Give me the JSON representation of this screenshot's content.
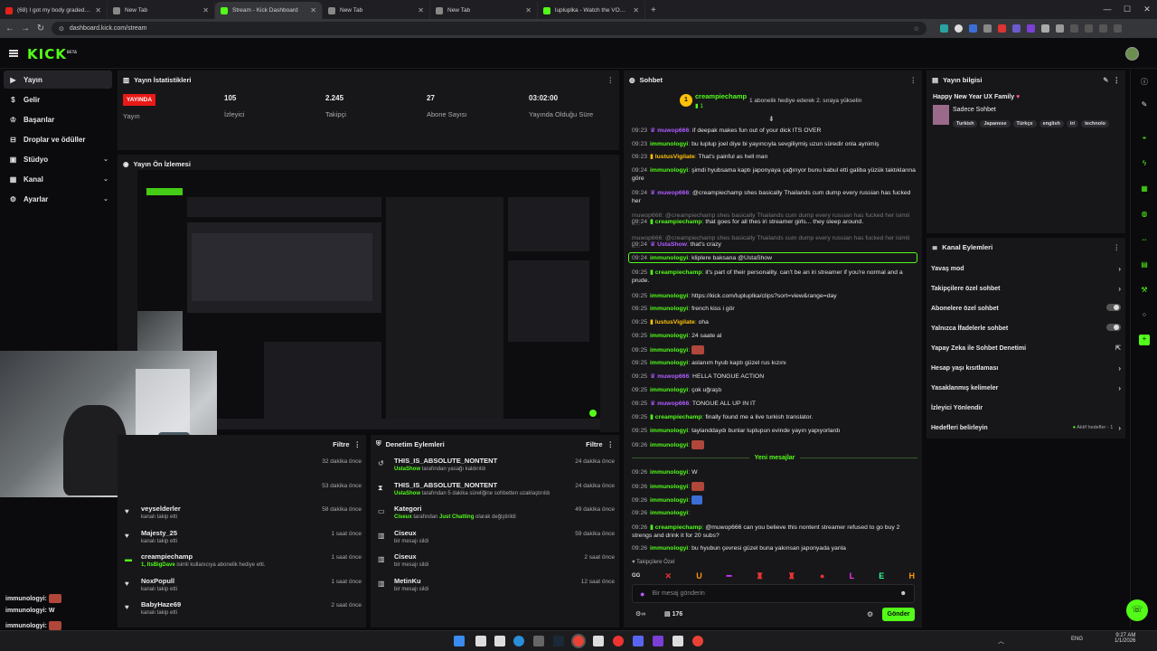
{
  "browser": {
    "tabs": [
      {
        "title": "(68) I got my body graded in a",
        "color": "#e62117"
      },
      {
        "title": "New Tab",
        "color": "#888888"
      },
      {
        "title": "Stream - Kick Dashboard",
        "color": "#53fc18"
      },
      {
        "title": "New Tab",
        "color": "#888888"
      },
      {
        "title": "New Tab",
        "color": "#888888"
      },
      {
        "title": "lupluplka - Watch the VOD on K",
        "color": "#53fc18"
      }
    ],
    "url": "dashboard.kick.com/stream"
  },
  "app": {
    "logo": "KICK",
    "logo_sup": "BETA"
  },
  "sidebar": {
    "items": [
      {
        "label": "Yayın",
        "icon": "stream-icon"
      },
      {
        "label": "Gelir",
        "icon": "revenue-icon"
      },
      {
        "label": "Başarılar",
        "icon": "trophy-icon"
      },
      {
        "label": "Droplar ve ödüller",
        "icon": "gift-icon"
      },
      {
        "label": "Stüdyo",
        "icon": "studio-icon"
      },
      {
        "label": "Kanal",
        "icon": "channel-icon"
      },
      {
        "label": "Ayarlar",
        "icon": "gear-icon"
      }
    ]
  },
  "stats": {
    "title": "Yayın İstatistikleri",
    "live_badge": "YAYINDA",
    "live_label": "Yayın",
    "viewers": "105",
    "viewers_label": "İzleyici",
    "followers": "2.245",
    "followers_label": "Takipçi",
    "subs": "27",
    "subs_label": "Abone Sayısı",
    "uptime": "03:02:00",
    "uptime_label": "Yayında Olduğu Süre"
  },
  "preview": {
    "title": "Yayın Ön İzlemesi"
  },
  "activity": {
    "filter": "Filtre",
    "items": [
      {
        "name": "",
        "sub": "",
        "time": "32 dakika önce"
      },
      {
        "name": "",
        "sub": "",
        "time": "53 dakika önce"
      },
      {
        "name": "veyselderler",
        "sub": "kanalı takip etti",
        "time": "58 dakika önce"
      },
      {
        "name": "Majesty_25",
        "sub": "kanalı takip etti",
        "time": "1 saat önce"
      },
      {
        "name": "creampiechamp",
        "sub_green": "1,",
        "sub_green2": "ItsBigDave",
        "sub": " isimli kullanıcıya abonelik hediye etti.",
        "time": "1 saat önce"
      },
      {
        "name": "NoxPopull",
        "sub": "kanalı takip etti",
        "time": "1 saat önce"
      },
      {
        "name": "BabyHaze69",
        "sub": "kanalı takip etti",
        "time": "2 saat önce"
      }
    ]
  },
  "moderation": {
    "title": "Denetim Eylemleri",
    "filter": "Filtre",
    "items": [
      {
        "icon": "unban-icon",
        "name": "THIS_IS_ABSOLUTE_NONTENT",
        "actor": "UstaShow",
        "rest": " tarafından yasağı kaldırıldı",
        "time": "24 dakika önce"
      },
      {
        "icon": "timeout-icon",
        "name": "THIS_IS_ABSOLUTE_NONTENT",
        "actor": "UstaShow",
        "rest": " tarafından 5 dakika süreliğine sohbetten uzaklaştırıldı",
        "time": "24 dakika önce"
      },
      {
        "icon": "category-icon",
        "name": "Kategori",
        "actor": "Ciseux",
        "rest": " tarafından ",
        "extra": "Just Chatting",
        "rest2": " olarak değiştirildi",
        "time": "49 dakika önce"
      },
      {
        "icon": "trash-icon",
        "name": "Ciseux",
        "actor": "",
        "rest": "bir mesajı sildi",
        "time": "59 dakika önce"
      },
      {
        "icon": "trash-icon",
        "name": "Ciseux",
        "actor": "",
        "rest": "bir mesajı sildi",
        "time": "2 saat önce"
      },
      {
        "icon": "trash-icon",
        "name": "MetinKu",
        "actor": "",
        "rest": "bir mesajı sildi",
        "time": "12 saat önce"
      }
    ]
  },
  "chat": {
    "title": "Sohbet",
    "pinned_user": "creampiechamp",
    "pinned_count": "1",
    "pinned_text": "1 abonelik hediye ederek 2. sıraya yükselin",
    "new_messages": "Yeni mesajlar",
    "followers_only": "Takipçilere Özel",
    "input_placeholder": "Bir mesaj gönderin",
    "viewer_count": "176",
    "send": "Gönder",
    "messages": [
      {
        "t": "09:23",
        "u": "muwop666",
        "c": "p",
        "m": "if deepak makes fun out of your dick ITS OVER"
      },
      {
        "t": "09:23",
        "u": "immunologyi",
        "c": "g",
        "m": "bu luplup joel diye bi yayıncıyla sevgiliymiş uzun süredir onla aynimiş"
      },
      {
        "t": "09:23",
        "u": "lustusVigilate",
        "c": "y",
        "m": "That's painful as hell man"
      },
      {
        "t": "09:24",
        "u": "immunologyi",
        "c": "g",
        "m": "şimdi hyubsama kaptı japonyaya çağırıyor bunu kabul etti galiba yüzük taktıklarına göre"
      },
      {
        "t": "09:24",
        "u": "muwop666",
        "c": "p",
        "m": "@creampiechamp shes basically Thailands cum dump every russian has fucked her"
      },
      {
        "t": "",
        "u": "",
        "c": "dim",
        "m": "muwop666: @creampiechamp shes basically Thailands cum dump every russian has fucked her isimli k..."
      },
      {
        "t": "09:24",
        "u": "creampiechamp",
        "c": "g",
        "m": "that goes for all thes iri streamer girls... they sleep around."
      },
      {
        "t": "",
        "u": "",
        "c": "dim",
        "m": "muwop666: @creampiechamp shes basically Thailands cum dump every russian has fucked her isimli k..."
      },
      {
        "t": "09:24",
        "u": "UstaShow",
        "c": "p",
        "m": "that's crazy"
      },
      {
        "t": "09:24",
        "u": "immunologyi",
        "c": "g",
        "m": "kliplere baksana @UstaShow"
      },
      {
        "t": "09:25",
        "u": "creampiechamp",
        "c": "g",
        "m": "it's part of their personality. can't be an iri streamer if you're normal and a prude."
      },
      {
        "t": "09:25",
        "u": "immunologyi",
        "c": "g",
        "m": "https://kick.com/lupluplka/clips?sort=view&range=day"
      },
      {
        "t": "09:25",
        "u": "immunologyi",
        "c": "g",
        "m": "french kiss i gör"
      },
      {
        "t": "09:25",
        "u": "lustusVigilate",
        "c": "y",
        "m": "oha"
      },
      {
        "t": "09:25",
        "u": "immunologyi",
        "c": "g",
        "m": "24 saate al"
      },
      {
        "t": "09:25",
        "u": "immunologyi",
        "c": "g",
        "m": "",
        "emote": true
      },
      {
        "t": "09:25",
        "u": "immunologyi",
        "c": "g",
        "m": "aslanım hyub kaptı güzel rus kızını"
      },
      {
        "t": "09:25",
        "u": "muwop666",
        "c": "p",
        "m": "HELLA TONGUE ACTION"
      },
      {
        "t": "09:25",
        "u": "immunologyi",
        "c": "g",
        "m": "çok uğraştı"
      },
      {
        "t": "09:25",
        "u": "muwop666",
        "c": "p",
        "m": "TONGUE ALL UP IN IT"
      },
      {
        "t": "09:25",
        "u": "creampiechamp",
        "c": "g",
        "m": "finally found me a live turkish translator."
      },
      {
        "t": "09:25",
        "u": "immunologyi",
        "c": "g",
        "m": "taylanddaydı bunlar luplupun evinde yayın yapıyorlardı"
      },
      {
        "t": "09:26",
        "u": "immunologyi",
        "c": "g",
        "m": "",
        "emote": true
      },
      {
        "t": "09:26",
        "u": "immunologyi",
        "c": "g",
        "m": "W"
      },
      {
        "t": "09:26",
        "u": "immunologyi",
        "c": "g",
        "m": "",
        "emote": true
      },
      {
        "t": "09:26",
        "u": "immunologyi",
        "c": "g",
        "m": "",
        "emote2": true
      },
      {
        "t": "09:26",
        "u": "immunologyi",
        "c": "g",
        "m": ""
      },
      {
        "t": "09:26",
        "u": "creampiechamp",
        "c": "g",
        "m": "@muwop666 can you believe this nontent streamer refused to go buy 2 strengs and drink it for 20 subs?"
      },
      {
        "t": "09:26",
        "u": "immunologyi",
        "c": "g",
        "m": "bu hyubun çevresi güzel buna yakınsan japonyada yanla"
      }
    ]
  },
  "stream_info": {
    "title": "Yayın bilgisi",
    "stream_title": "Happy New Year UX Family",
    "category": "Sadece Sohbet",
    "tags": [
      "Turkish",
      "Japanese",
      "Türkçe",
      "english",
      "iri",
      "technolo"
    ]
  },
  "channel_actions": {
    "title": "Kanal Eylemleri",
    "items": [
      {
        "label": "Yavaş mod",
        "right": "chevron"
      },
      {
        "label": "Takipçilere özel sohbet",
        "right": "chevron"
      },
      {
        "label": "Abonelere özel sohbet",
        "right": "toggle"
      },
      {
        "label": "Yalnızca İfadelerle sohbet",
        "right": "toggle"
      },
      {
        "label": "Yapay Zeka ile Sohbet Denetimi",
        "right": "external"
      },
      {
        "label": "Hesap yaşı kısıtlaması",
        "right": "chevron"
      },
      {
        "label": "Yasaklanmış kelimeler",
        "right": "chevron"
      },
      {
        "label": "İzleyici Yönlendir",
        "right": ""
      },
      {
        "label": "Hedefleri belirleyin",
        "right": "chevron",
        "badge": "Aktif hedefler - 1"
      }
    ]
  },
  "overlay_chat": [
    {
      "u": "immunologyi:",
      "m": ""
    },
    {
      "u": "immunologyi:",
      "m": "W"
    },
    {
      "u": "immunologyi:",
      "m": ""
    },
    {
      "u": "immunologyi:",
      "m": ""
    }
  ],
  "taskbar": {
    "lang": "ENG",
    "time": "9:27 AM",
    "date": "1/1/2026"
  },
  "colors": {
    "accent": "#53fc18",
    "live": "#e91916",
    "purple": "#b05cff",
    "gold": "#ffc107"
  }
}
